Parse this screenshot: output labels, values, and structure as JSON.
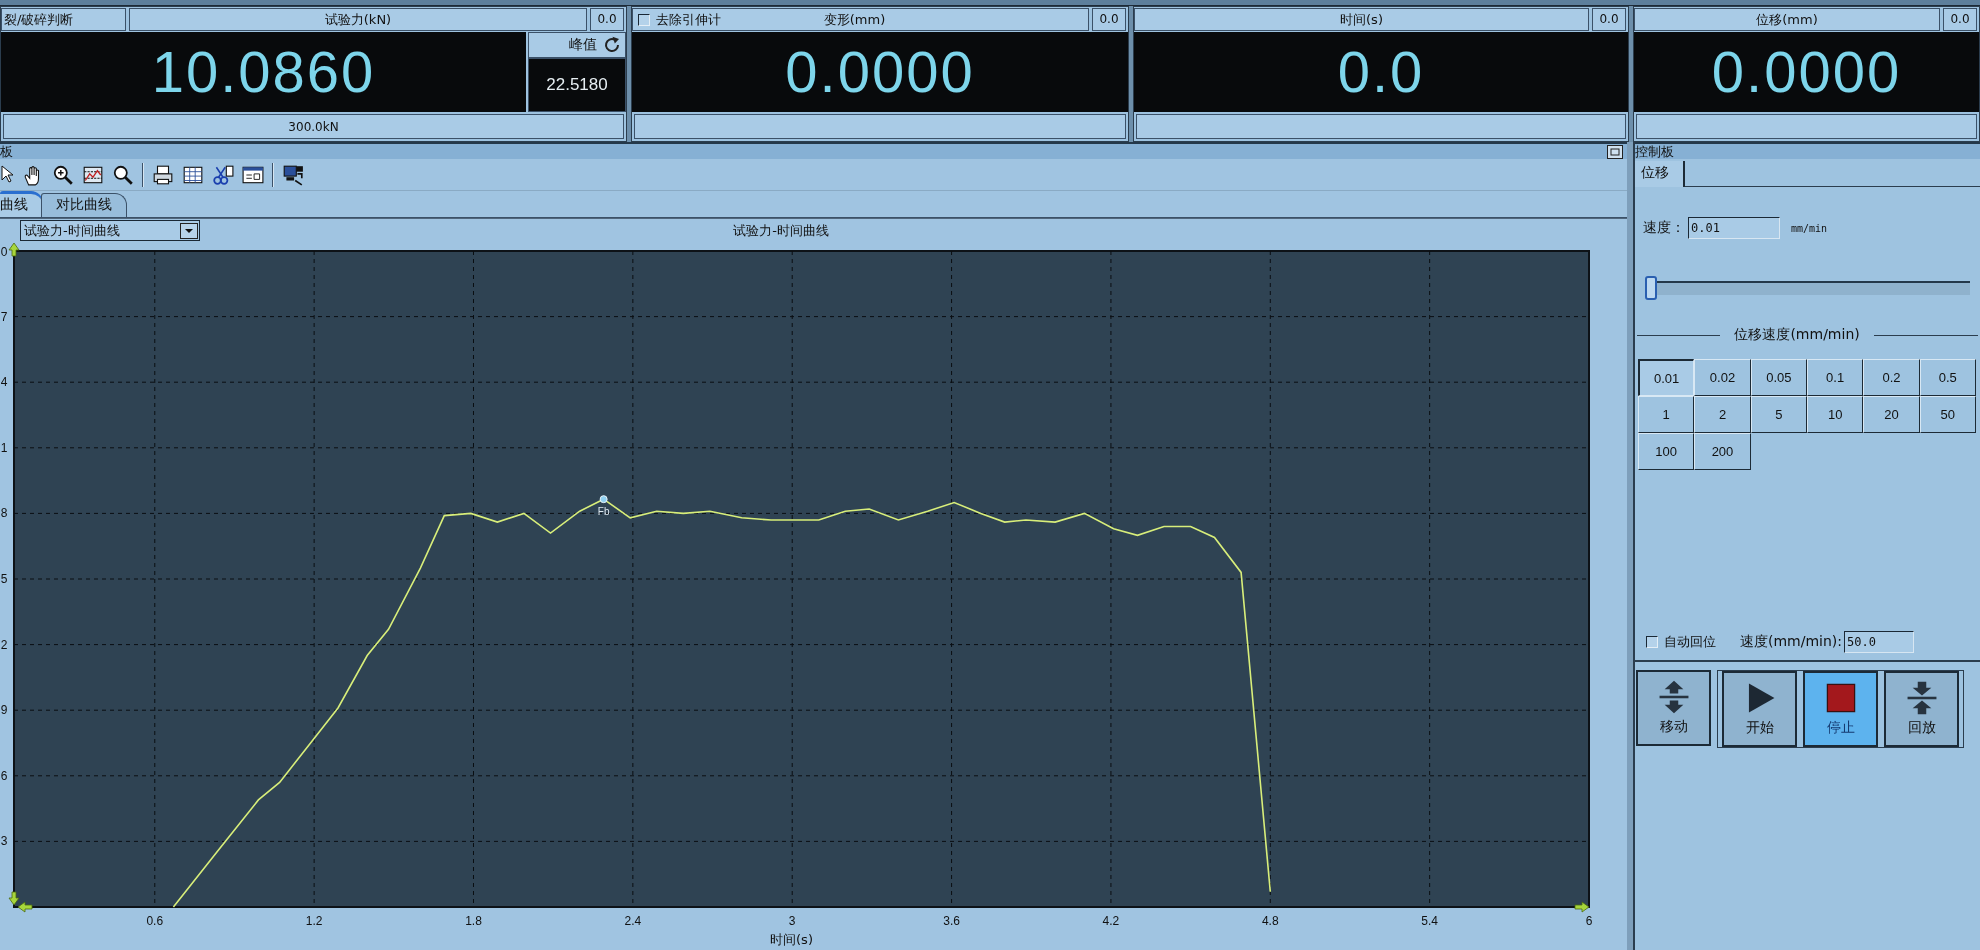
{
  "top_panels": [
    {
      "judge_label": "裂/破碎判断",
      "title": "试验力(kN)",
      "corner_value": "0.0",
      "reading": "10.0860",
      "peak": {
        "label": "峰值",
        "value": "22.5180"
      },
      "footer": "300.0kN"
    },
    {
      "checkbox": {
        "label": "去除引伸计",
        "checked": false
      },
      "title": "变形(mm)",
      "corner_value": "0.0",
      "reading": "0.0000"
    },
    {
      "title": "时间(s)",
      "corner_value": "0.0",
      "reading": "0.0"
    },
    {
      "title": "位移(mm)",
      "corner_value": "0.0",
      "reading": "0.0000"
    }
  ],
  "curve_panel": {
    "title": "板",
    "tabs": [
      {
        "label": "曲线",
        "selected": true
      },
      {
        "label": "对比曲线",
        "selected": false
      }
    ],
    "curve_select": {
      "value": "试验力-时间曲线"
    },
    "chart": {
      "title": "试验力-时间曲线",
      "y_tick_labels": [
        "0",
        "7",
        "4",
        "1",
        "8",
        "5",
        "2",
        "9",
        "6",
        "3"
      ],
      "x_tick_labels": [
        "0.6",
        "1.2",
        "1.8",
        "2.4",
        "3",
        "3.6",
        "4.2",
        "4.8",
        "5.4",
        "6"
      ],
      "x_axis_title": "时间(s)",
      "peak_label": "Fb"
    }
  },
  "control_panel": {
    "title": "控制板",
    "tabs": [
      {
        "label": "位移",
        "selected": true
      }
    ],
    "speed": {
      "label": "速度：",
      "value": "0.01",
      "unit": "mm/min"
    },
    "slider": {
      "level": 0
    },
    "preset_title": "位移速度(mm/min)",
    "presets": [
      {
        "label": "0.01",
        "selected": true
      },
      {
        "label": "0.02",
        "selected": false
      },
      {
        "label": "0.05",
        "selected": false
      },
      {
        "label": "0.1",
        "selected": false
      },
      {
        "label": "0.2",
        "selected": false
      },
      {
        "label": "0.5",
        "selected": false
      },
      {
        "label": "1",
        "selected": false
      },
      {
        "label": "2",
        "selected": false
      },
      {
        "label": "5",
        "selected": false
      },
      {
        "label": "10",
        "selected": false
      },
      {
        "label": "20",
        "selected": false
      },
      {
        "label": "50",
        "selected": false
      },
      {
        "label": "100",
        "selected": false
      },
      {
        "label": "200",
        "selected": false
      }
    ],
    "auto_return": {
      "label": "自动回位",
      "checked": false
    },
    "return_speed": {
      "label": "速度(mm/min):",
      "value": "50.0"
    },
    "actions": [
      {
        "kind": "move",
        "label": "移动",
        "selected": false
      },
      {
        "kind": "start",
        "label": "开始",
        "selected": false
      },
      {
        "kind": "stop",
        "label": "停止",
        "selected": true
      },
      {
        "kind": "playback",
        "label": "回放",
        "selected": false
      }
    ]
  }
}
